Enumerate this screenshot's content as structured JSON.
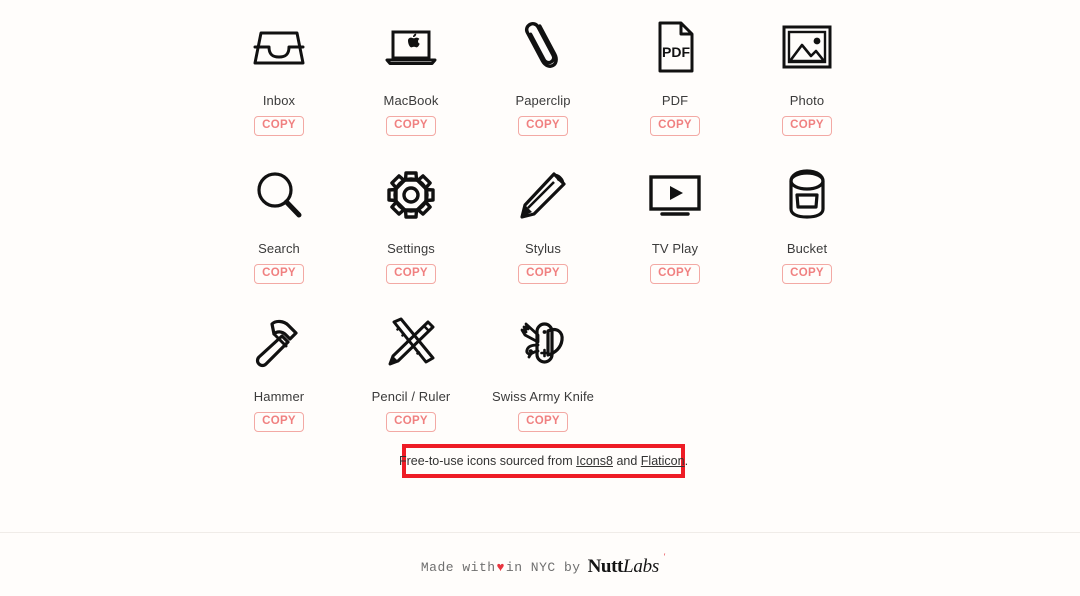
{
  "page": {
    "background_color": "#fffdfb",
    "label_color": "#3b3b3b",
    "copy_accent_color": "#f08080",
    "annotation_color": "#ee1c25",
    "heart_color": "#e8353f"
  },
  "gallery": {
    "copy_label": "COPY",
    "rows": [
      [
        {
          "icon": "inbox-tray-icon",
          "label": "Inbox",
          "copy": "COPY"
        },
        {
          "icon": "macbook-laptop-icon",
          "label": "MacBook",
          "copy": "COPY"
        },
        {
          "icon": "paperclip-icon",
          "label": "Paperclip",
          "copy": "COPY"
        },
        {
          "icon": "pdf-document-icon",
          "label": "PDF",
          "copy": "COPY"
        },
        {
          "icon": "photo-picture-icon",
          "label": "Photo",
          "copy": "COPY"
        }
      ],
      [
        {
          "icon": "search-magnifier-icon",
          "label": "Search",
          "copy": "COPY"
        },
        {
          "icon": "settings-gear-icon",
          "label": "Settings",
          "copy": "COPY"
        },
        {
          "icon": "stylus-pencil-icon",
          "label": "Stylus",
          "copy": "COPY"
        },
        {
          "icon": "tv-play-icon",
          "label": "TV Play",
          "copy": "COPY"
        },
        {
          "icon": "bucket-paint-can-icon",
          "label": "Bucket",
          "copy": "COPY"
        }
      ],
      [
        {
          "icon": "hammer-icon",
          "label": "Hammer",
          "copy": "COPY"
        },
        {
          "icon": "pencil-ruler-icon",
          "label": "Pencil / Ruler",
          "copy": "COPY"
        },
        {
          "icon": "swiss-army-knife-icon",
          "label": "Swiss Army Knife",
          "copy": "COPY"
        }
      ]
    ]
  },
  "credit": {
    "prefix": "Free-to-use icons sourced from ",
    "link1": "Icons8",
    "middle": " and ",
    "link2": "Flaticon",
    "suffix": "."
  },
  "footer": {
    "before_heart": "Made with",
    "heart": "♥",
    "after_heart": "in NYC by",
    "brand_bold": "Nutt",
    "brand_italic": "Labs",
    "brand_mark": "′"
  }
}
